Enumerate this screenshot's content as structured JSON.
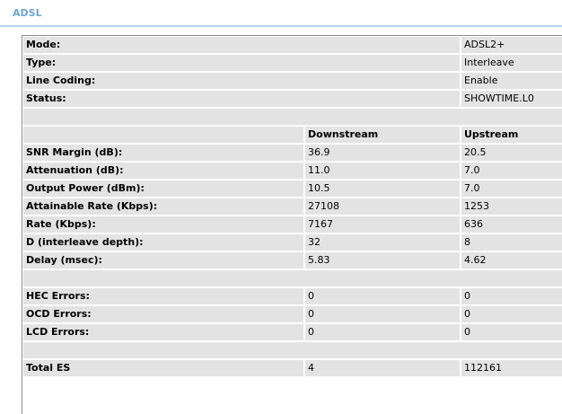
{
  "section": {
    "title": "ADSL"
  },
  "info": [
    {
      "label": "Mode:",
      "value": "ADSL2+"
    },
    {
      "label": "Type:",
      "value": "Interleave"
    },
    {
      "label": "Line Coding:",
      "value": "Enable"
    },
    {
      "label": "Status:",
      "value": "SHOWTIME.L0"
    }
  ],
  "columns": {
    "downstream": "Downstream",
    "upstream": "Upstream"
  },
  "stats": [
    {
      "label": "SNR Margin (dB):",
      "down": "36.9",
      "up": "20.5"
    },
    {
      "label": "Attenuation (dB):",
      "down": "11.0",
      "up": "7.0"
    },
    {
      "label": "Output Power (dBm):",
      "down": "10.5",
      "up": "7.0"
    },
    {
      "label": "Attainable Rate (Kbps):",
      "down": "27108",
      "up": "1253"
    },
    {
      "label": "Rate (Kbps):",
      "down": "7167",
      "up": "636"
    },
    {
      "label": "D (interleave depth):",
      "down": "32",
      "up": "8"
    },
    {
      "label": "Delay (msec):",
      "down": "5.83",
      "up": "4.62"
    }
  ],
  "errors": [
    {
      "label": "HEC Errors:",
      "down": "0",
      "up": "0"
    },
    {
      "label": "OCD Errors:",
      "down": "0",
      "up": "0"
    },
    {
      "label": "LCD Errors:",
      "down": "0",
      "up": "0"
    }
  ],
  "totals": [
    {
      "label": "Total ES",
      "down": "4",
      "up": "112161"
    }
  ]
}
